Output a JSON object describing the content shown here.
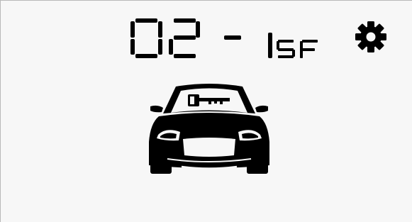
{
  "display": {
    "code": "02 - 1SF"
  },
  "icons": {
    "settings": "gear-icon",
    "car": "car-key-icon"
  },
  "colors": {
    "background": "#f7f7f7",
    "foreground": "#000000",
    "border": "#b9b9b9"
  }
}
